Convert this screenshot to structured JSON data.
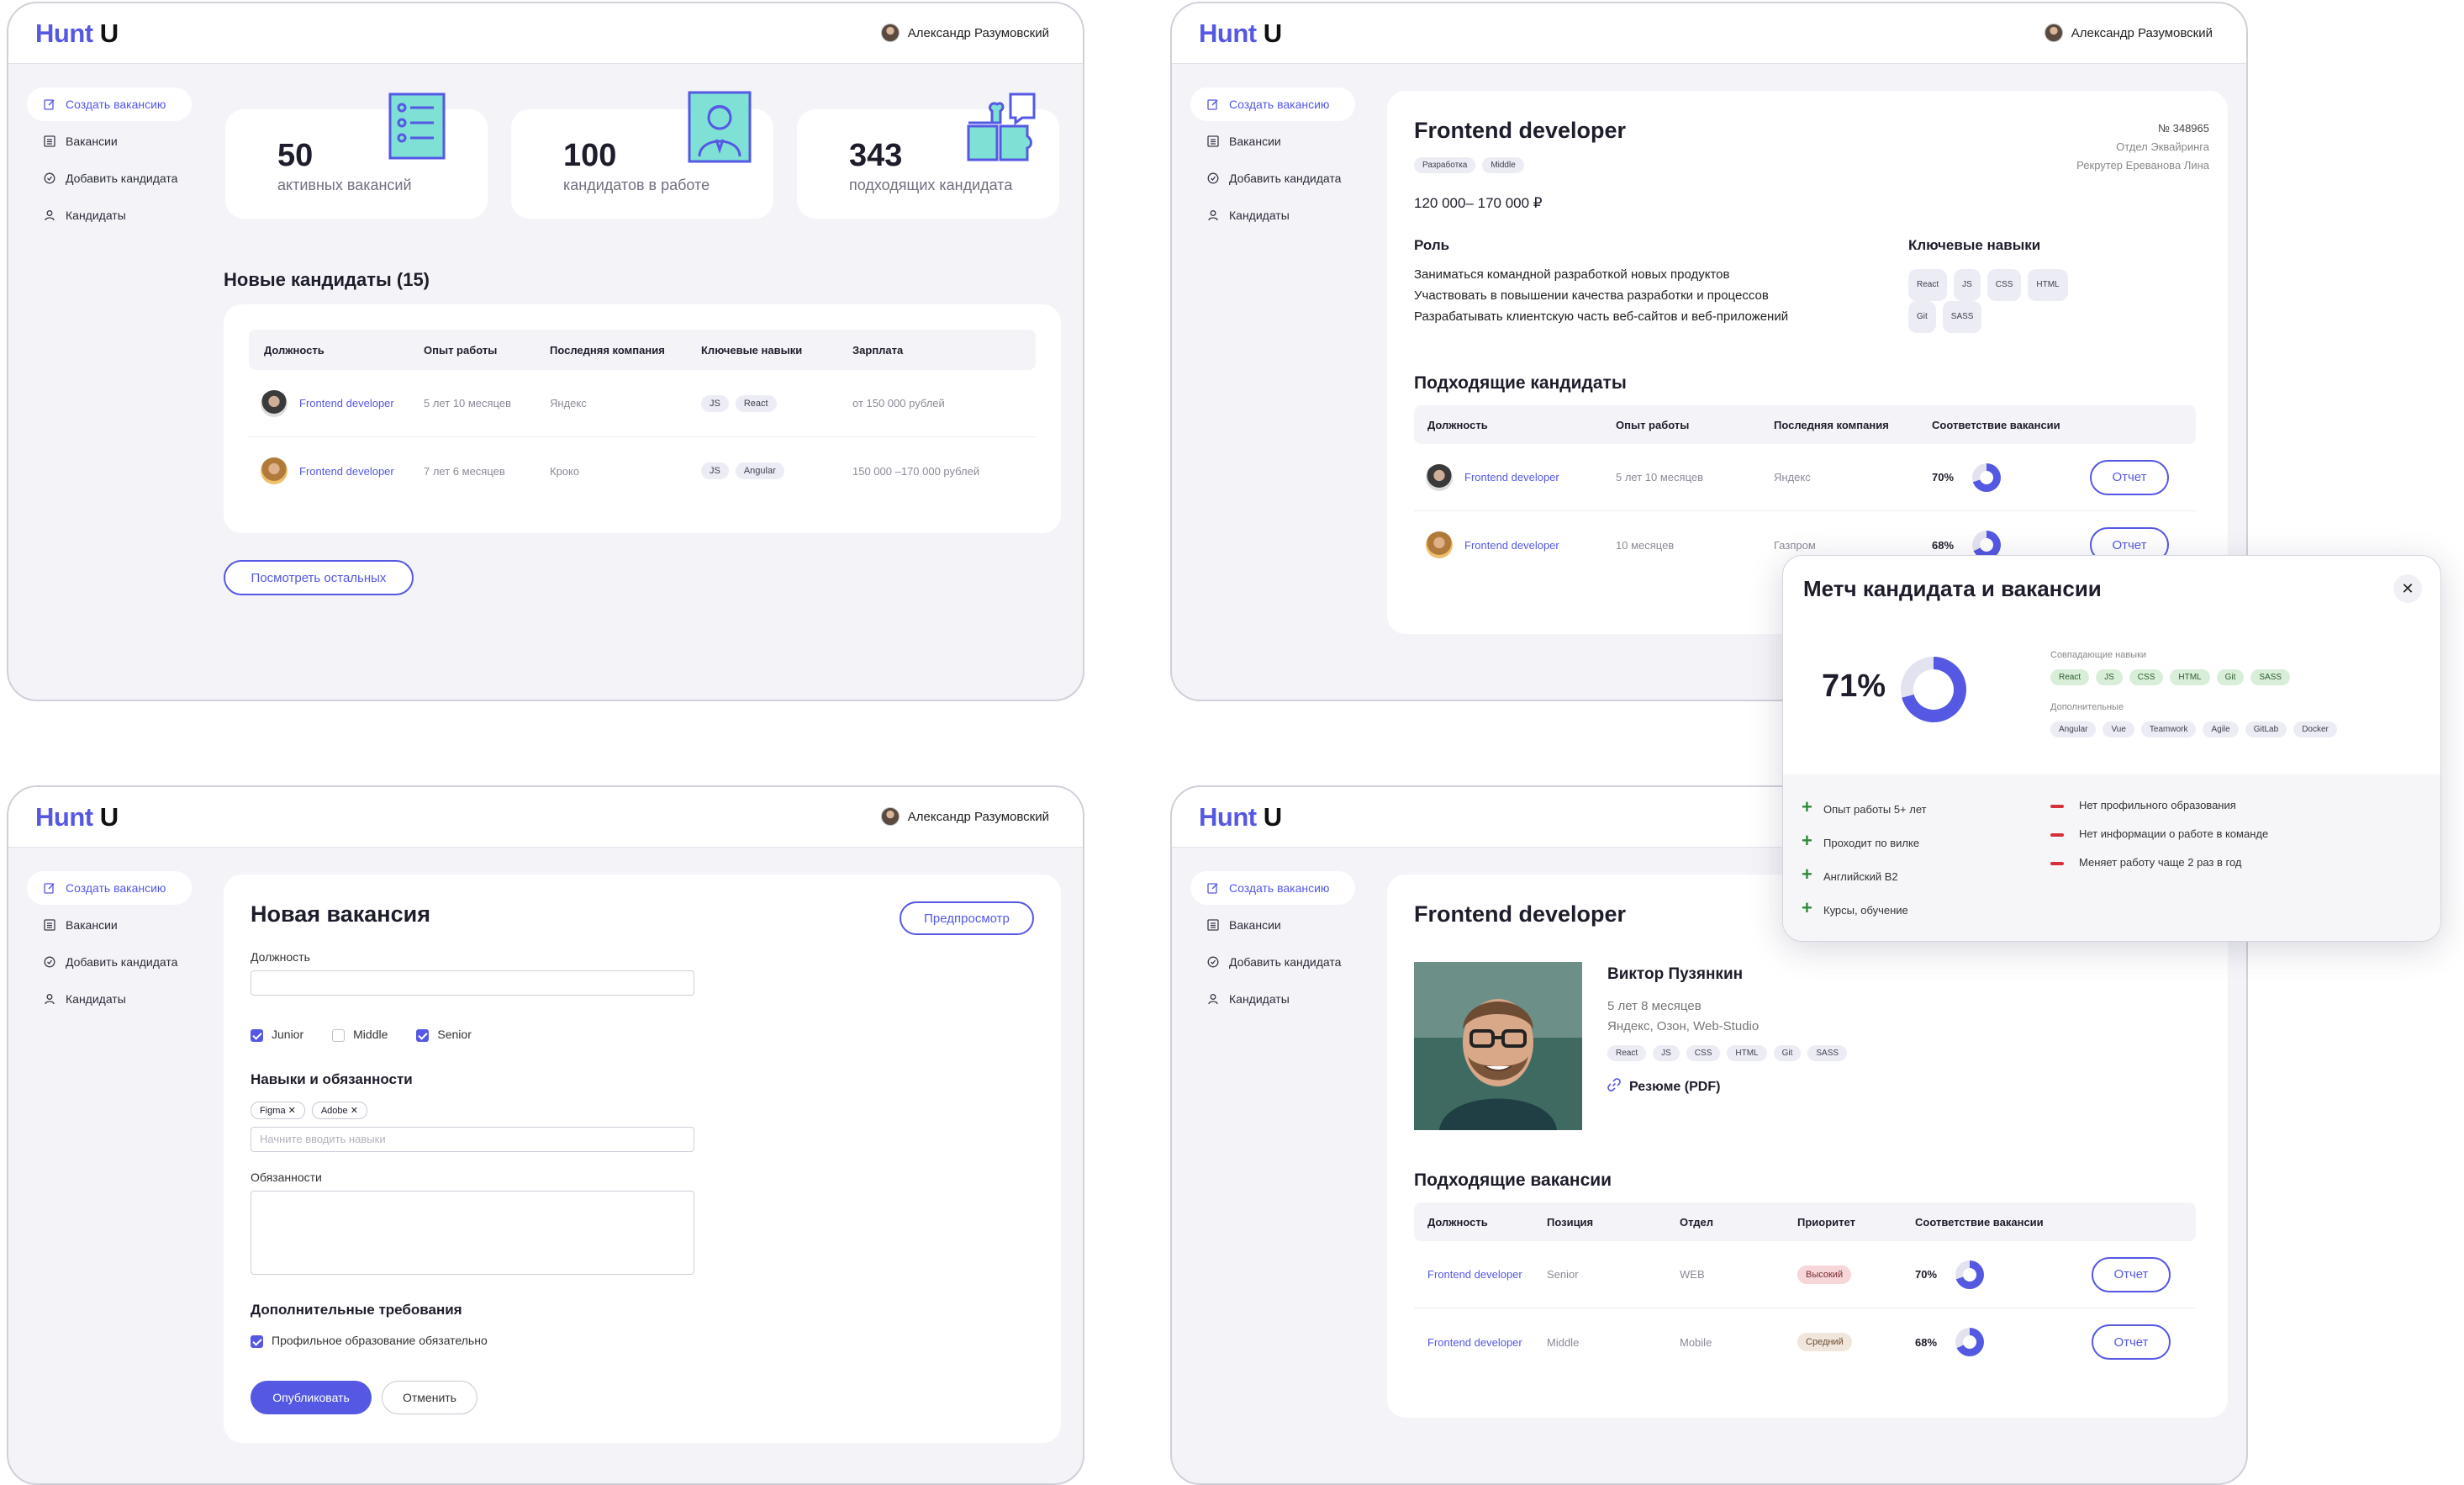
{
  "app": {
    "logo_part1": "Hunt",
    "logo_part2": "U",
    "user_name": "Александр Разумовский"
  },
  "sidebar": {
    "items": [
      {
        "label": "Создать вакансию",
        "icon": "edit-icon"
      },
      {
        "label": "Вакансии",
        "icon": "list-icon"
      },
      {
        "label": "Добавить кандидата",
        "icon": "check-circle-icon"
      },
      {
        "label": "Кандидаты",
        "icon": "person-icon"
      }
    ]
  },
  "dashboard": {
    "stats": [
      {
        "value": "50",
        "label": "активных вакансий"
      },
      {
        "value": "100",
        "label": "кандидатов в работе"
      },
      {
        "value": "343",
        "label": "подходящих кандидата"
      }
    ],
    "new_candidates_title": "Новые кандидаты (15)",
    "table_headers": [
      "Должность",
      "Опыт работы",
      "Последняя компания",
      "Ключевые навыки",
      "Зарплата"
    ],
    "rows": [
      {
        "position": "Frontend developer",
        "experience": "5 лет 10 месяцев",
        "company": "Яндекс",
        "skills": [
          "JS",
          "React"
        ],
        "salary": "от 150 000 рублей"
      },
      {
        "position": "Frontend developer",
        "experience": "7 лет 6 месяцев",
        "company": "Кроко",
        "skills": [
          "JS",
          "Angular"
        ],
        "salary": "150 000 –170 000 рублей"
      }
    ],
    "view_more": "Посмотреть остальных"
  },
  "vacancy": {
    "title": "Frontend developer",
    "tags": [
      "Разработка",
      "Middle"
    ],
    "number": "№ 348965",
    "department": "Отдел Эквайринга",
    "recruiter": "Рекрутер Ереванова Лина",
    "salary": "120 000– 170 000 ₽",
    "role_title": "Роль",
    "role_lines": [
      "Заниматься командной разработкой новых продуктов",
      "Участвовать в повышении качества разработки и процессов",
      "Разрабатывать клиентскую часть веб-сайтов и веб-приложений"
    ],
    "skills_title": "Ключевые навыки",
    "skills": [
      "React",
      "JS",
      "CSS",
      "HTML",
      "Git",
      "SASS"
    ],
    "candidates_title": "Подходящие кандидаты",
    "cand_headers": [
      "Должность",
      "Опыт  работы",
      "Последняя компания",
      "Соответствие вакансии"
    ],
    "cand_rows": [
      {
        "position": "Frontend developer",
        "experience": "5 лет 10 месяцев",
        "company": "Яндекс",
        "match": "70%",
        "match_value": 70,
        "action": "Отчет"
      },
      {
        "position": "Frontend developer",
        "experience": "10 месяцев",
        "company": "Газпром",
        "match": "68%",
        "match_value": 68,
        "action": "Отчет"
      }
    ]
  },
  "modal": {
    "title": "Метч кандидата и вакансии",
    "percent": "71%",
    "percent_value": 71,
    "matching_label": "Совпадающие навыки",
    "matching": [
      "React",
      "JS",
      "CSS",
      "HTML",
      "Git",
      "SASS"
    ],
    "additional_label": "Дополнительные",
    "additional": [
      "Angular",
      "Vue",
      "Teamwork",
      "Agile",
      "GitLab",
      "Docker"
    ],
    "pros": [
      "Опыт работы 5+ лет",
      "Проходит по вилке",
      "Английский B2",
      "Курсы, обучение"
    ],
    "cons": [
      "Нет профильного образования",
      "Нет информации о работе в команде",
      "Меняет работу чаще 2 раз в год"
    ]
  },
  "new_vacancy": {
    "title": "Новая вакансия",
    "preview": "Предпросмотр",
    "position_label": "Должность",
    "levels": [
      {
        "label": "Junior",
        "checked": true
      },
      {
        "label": "Middle",
        "checked": false
      },
      {
        "label": "Senior",
        "checked": true
      }
    ],
    "skills_title": "Навыки и обязанности",
    "chips": [
      "Figma",
      "Adobe"
    ],
    "skills_placeholder": "Начните вводить навыки",
    "duties_label": "Обязанности",
    "extra_title": "Дополнительные требования",
    "extra_checkbox": "Профильное образование обязательно",
    "publish": "Опубликовать",
    "cancel": "Отменить"
  },
  "candidate": {
    "vacancy_title": "Frontend developer",
    "name": "Виктор Пузянкин",
    "experience": "5 лет 8 месяцев",
    "companies": "Яндекс, Озон, Web-Studio",
    "skills": [
      "React",
      "JS",
      "CSS",
      "HTML",
      "Git",
      "SASS"
    ],
    "resume": "Резюме (PDF)",
    "vacancies_title": "Подходящие вакансии",
    "headers": [
      "Должность",
      "Позиция",
      "Отдел",
      "Приоритет",
      "Соответствие вакансии"
    ],
    "rows": [
      {
        "position": "Frontend developer",
        "level": "Senior",
        "dept": "WEB",
        "priority": "Высокий",
        "match": "70%",
        "match_value": 70,
        "action": "Отчет"
      },
      {
        "position": "Frontend developer",
        "level": "Middle",
        "dept": "Mobile",
        "priority": "Средний",
        "match": "68%",
        "match_value": 68,
        "action": "Отчет"
      }
    ]
  },
  "colors": {
    "accent": "#5558e3",
    "positive": "#2f8a3a",
    "negative": "#d6303a"
  }
}
